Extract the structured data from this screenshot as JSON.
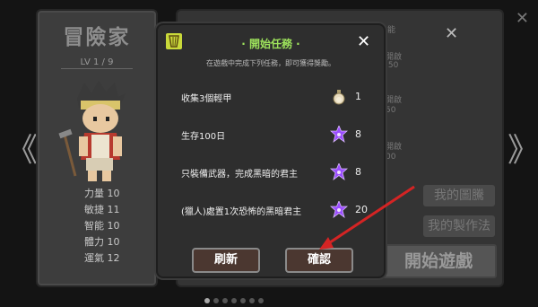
{
  "character": {
    "title": "冒險家",
    "level": "LV 1 / 9",
    "stats": [
      {
        "name": "力量",
        "value": "10"
      },
      {
        "name": "敏捷",
        "value": "11"
      },
      {
        "name": "智能",
        "value": "10"
      },
      {
        "name": "體力",
        "value": "10"
      },
      {
        "name": "運氣",
        "value": "12"
      }
    ]
  },
  "background": {
    "items": [
      "能",
      "開啟",
      ".50",
      "開啟",
      "50",
      "開啟",
      "00"
    ],
    "my_totem": "我的圖騰",
    "my_recipe": "我的製作法",
    "start_game": "開始遊戲"
  },
  "nav": {
    "prev": "《",
    "next": "》",
    "close": "✕"
  },
  "modal": {
    "title": "· 開始任務 ·",
    "subtitle": "在遊戲中完成下列任務，即可獲得獎勵。",
    "close": "✕",
    "tasks": [
      {
        "label": "收集3個輕甲",
        "icon": "potion-icon",
        "count": "1"
      },
      {
        "label": "生存100日",
        "icon": "purple-star-icon",
        "count": "8"
      },
      {
        "label": "只裝備武器，完成黑暗的君主",
        "icon": "purple-star-icon",
        "count": "8"
      },
      {
        "label": "(獵人)處置1次恐怖的黑暗君主",
        "icon": "purple-star-icon",
        "count": "20"
      }
    ],
    "refresh": "刷新",
    "confirm": "確認"
  },
  "pagination": {
    "total": 7,
    "current": 1
  },
  "colors": {
    "title_green": "#9ee35c",
    "star_purple": "#9b4dff",
    "arrow_red": "#d42424",
    "button_brown": "#4b3730"
  }
}
